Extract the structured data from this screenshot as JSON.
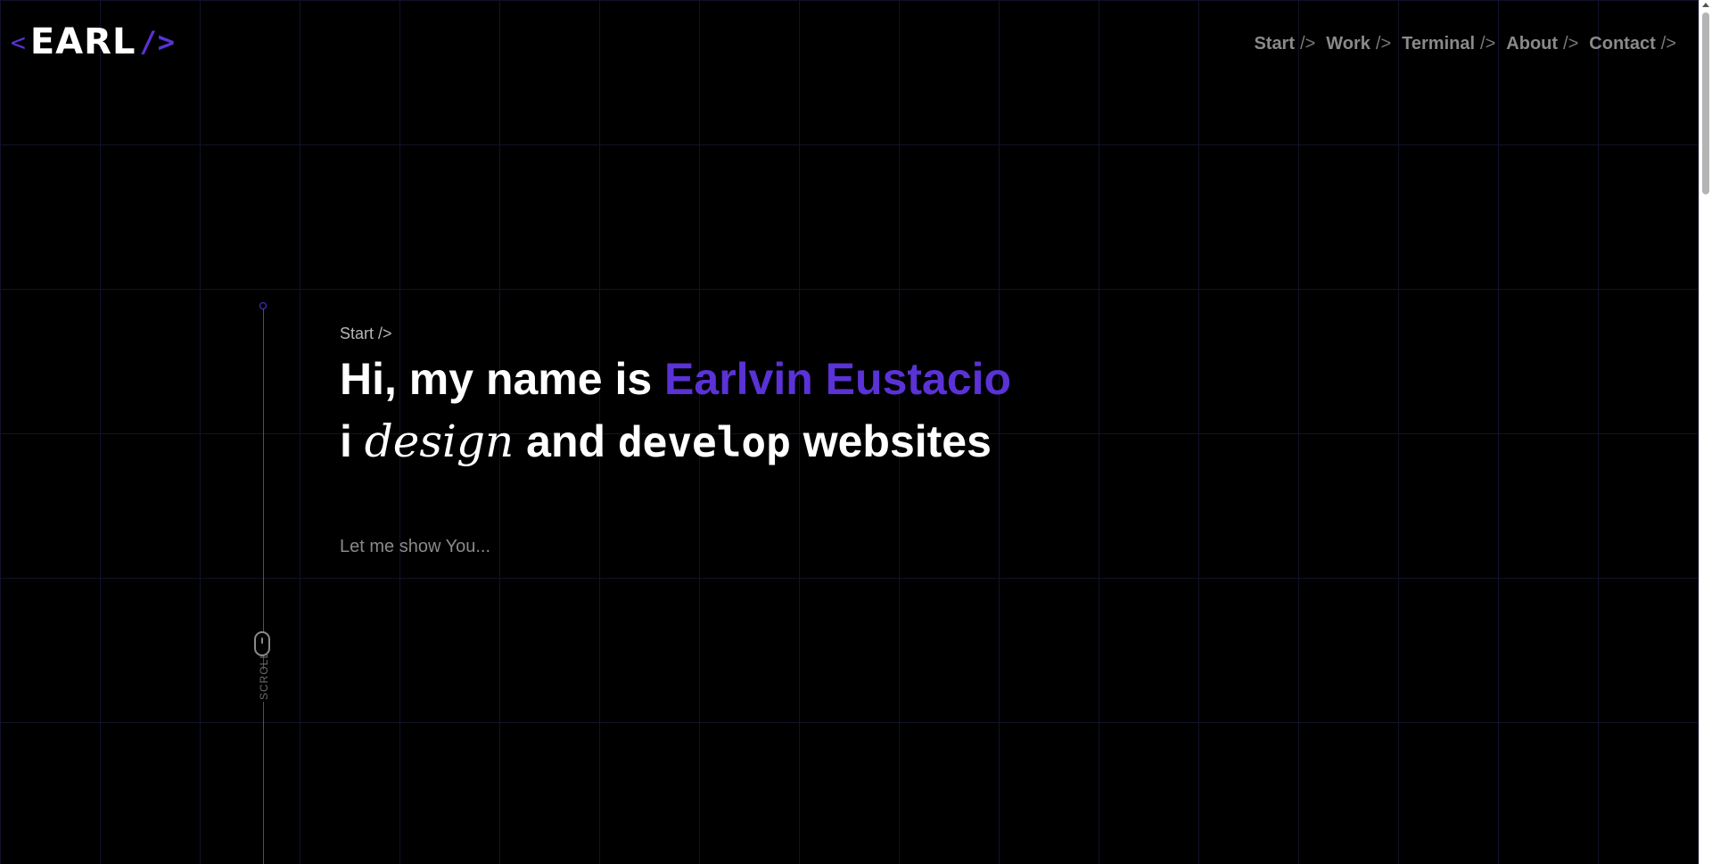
{
  "header": {
    "logo": {
      "open_bracket": "<",
      "word": "EARL",
      "close": "/>"
    },
    "nav": [
      {
        "label": "Start",
        "suffix": "/>"
      },
      {
        "label": "Work",
        "suffix": "/>"
      },
      {
        "label": "Terminal",
        "suffix": "/>"
      },
      {
        "label": "About",
        "suffix": "/>"
      },
      {
        "label": "Contact",
        "suffix": "/>"
      }
    ]
  },
  "hero": {
    "breadcrumb": "Start />",
    "line1_prefix": "Hi, my name is ",
    "line1_name": "Earlvin Eustacio",
    "line2_i": "i ",
    "line2_design": "design",
    "line2_and": " and ",
    "line2_develop": "develop",
    "line2_websites": " websites",
    "subtext": "Let me show You..."
  },
  "scroll_indicator": {
    "label": "SCROLL"
  },
  "colors": {
    "accent": "#5a32d6",
    "background": "#000000",
    "grid": "#10122a",
    "text": "#ffffff",
    "muted": "#8a8a8a"
  },
  "icons": {
    "mouse": "mouse-icon"
  }
}
